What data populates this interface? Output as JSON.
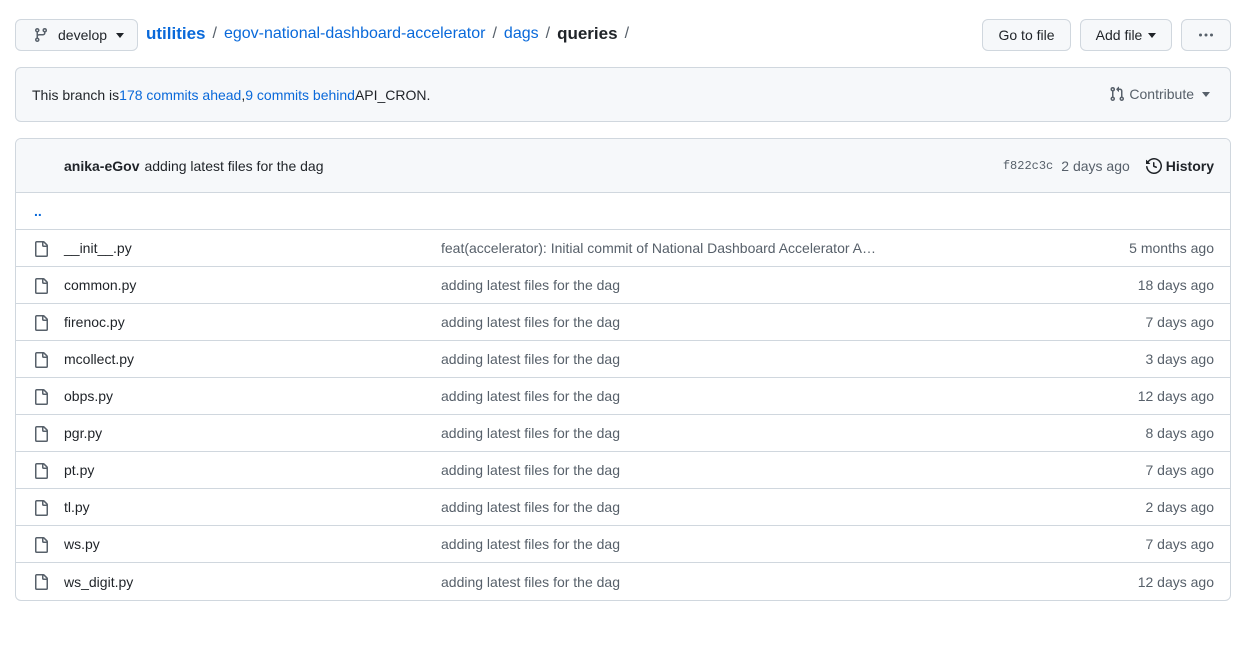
{
  "toolbar": {
    "branch": "develop",
    "breadcrumb": {
      "root": "utilities",
      "parts": [
        "egov-national-dashboard-accelerator",
        "dags"
      ],
      "current": "queries",
      "separator": "/"
    },
    "go_to_file": "Go to file",
    "add_file": "Add file",
    "more": "···"
  },
  "branch_info": {
    "prefix": "This branch is ",
    "ahead": "178 commits ahead",
    "comma": ", ",
    "behind": "9 commits behind",
    "suffix": " API_CRON.",
    "contribute": "Contribute"
  },
  "latest_commit": {
    "author": "anika-eGov",
    "message": "adding latest files for the dag",
    "sha": "f822c3c",
    "date": "2 days ago",
    "history": "History"
  },
  "parent_dir": "..",
  "files": [
    {
      "name": "__init__.py",
      "message": "feat(accelerator): Initial commit of National Dashboard Accelerator A…",
      "date": "5 months ago"
    },
    {
      "name": "common.py",
      "message": "adding latest files for the dag",
      "date": "18 days ago"
    },
    {
      "name": "firenoc.py",
      "message": "adding latest files for the dag",
      "date": "7 days ago"
    },
    {
      "name": "mcollect.py",
      "message": "adding latest files for the dag",
      "date": "3 days ago"
    },
    {
      "name": "obps.py",
      "message": "adding latest files for the dag",
      "date": "12 days ago"
    },
    {
      "name": "pgr.py",
      "message": "adding latest files for the dag",
      "date": "8 days ago"
    },
    {
      "name": "pt.py",
      "message": "adding latest files for the dag",
      "date": "7 days ago"
    },
    {
      "name": "tl.py",
      "message": "adding latest files for the dag",
      "date": "2 days ago"
    },
    {
      "name": "ws.py",
      "message": "adding latest files for the dag",
      "date": "7 days ago"
    },
    {
      "name": "ws_digit.py",
      "message": "adding latest files for the dag",
      "date": "12 days ago"
    }
  ],
  "colors": {
    "link": "#0969da",
    "border": "#d0d7de",
    "muted": "#57606a",
    "header_bg": "#f6f8fa"
  }
}
